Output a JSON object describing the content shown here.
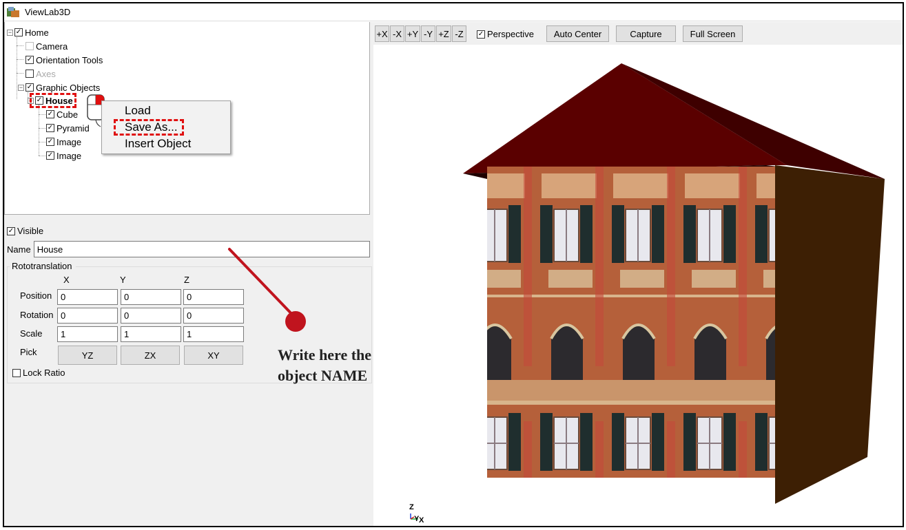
{
  "window": {
    "title": "ViewLab3D"
  },
  "tree": {
    "home": "Home",
    "camera": "Camera",
    "orientation_tools": "Orientation Tools",
    "axes": "Axes",
    "graphic_objects": "Graphic Objects",
    "house": "House",
    "cube": "Cube",
    "pyramid": "Pyramid",
    "image1": "Image",
    "image2": "Image"
  },
  "context_menu": {
    "load": "Load",
    "save_as": "Save As...",
    "insert_object": "Insert Object"
  },
  "properties": {
    "visible_label": "Visible",
    "name_label": "Name",
    "name_value": "House",
    "group_title": "Rototranslation",
    "axes": {
      "x": "X",
      "y": "Y",
      "z": "Z"
    },
    "position_label": "Position",
    "rotation_label": "Rotation",
    "scale_label": "Scale",
    "pick_label": "Pick",
    "position": [
      "0",
      "0",
      "0"
    ],
    "rotation": [
      "0",
      "0",
      "0"
    ],
    "scale": [
      "1",
      "1",
      "1"
    ],
    "pick_buttons": [
      "YZ",
      "ZX",
      "XY"
    ],
    "lock_ratio_label": "Lock Ratio"
  },
  "toolbar": {
    "plus_x": "+X",
    "minus_x": "-X",
    "plus_y": "+Y",
    "minus_y": "-Y",
    "plus_z": "+Z",
    "minus_z": "-Z",
    "perspective": "Perspective",
    "auto_center": "Auto Center",
    "capture": "Capture",
    "full_screen": "Full Screen"
  },
  "axis_indicator": {
    "z": "Z",
    "y": "Y",
    "x": "X"
  },
  "annotation": {
    "line1": "Write here the",
    "line2": "object NAME"
  },
  "colors": {
    "highlight": "#e01010",
    "roof": "#5a0000",
    "facade": "#b8623a",
    "side_wall": "#3d1f04",
    "annotation_line": "#c0141e"
  }
}
